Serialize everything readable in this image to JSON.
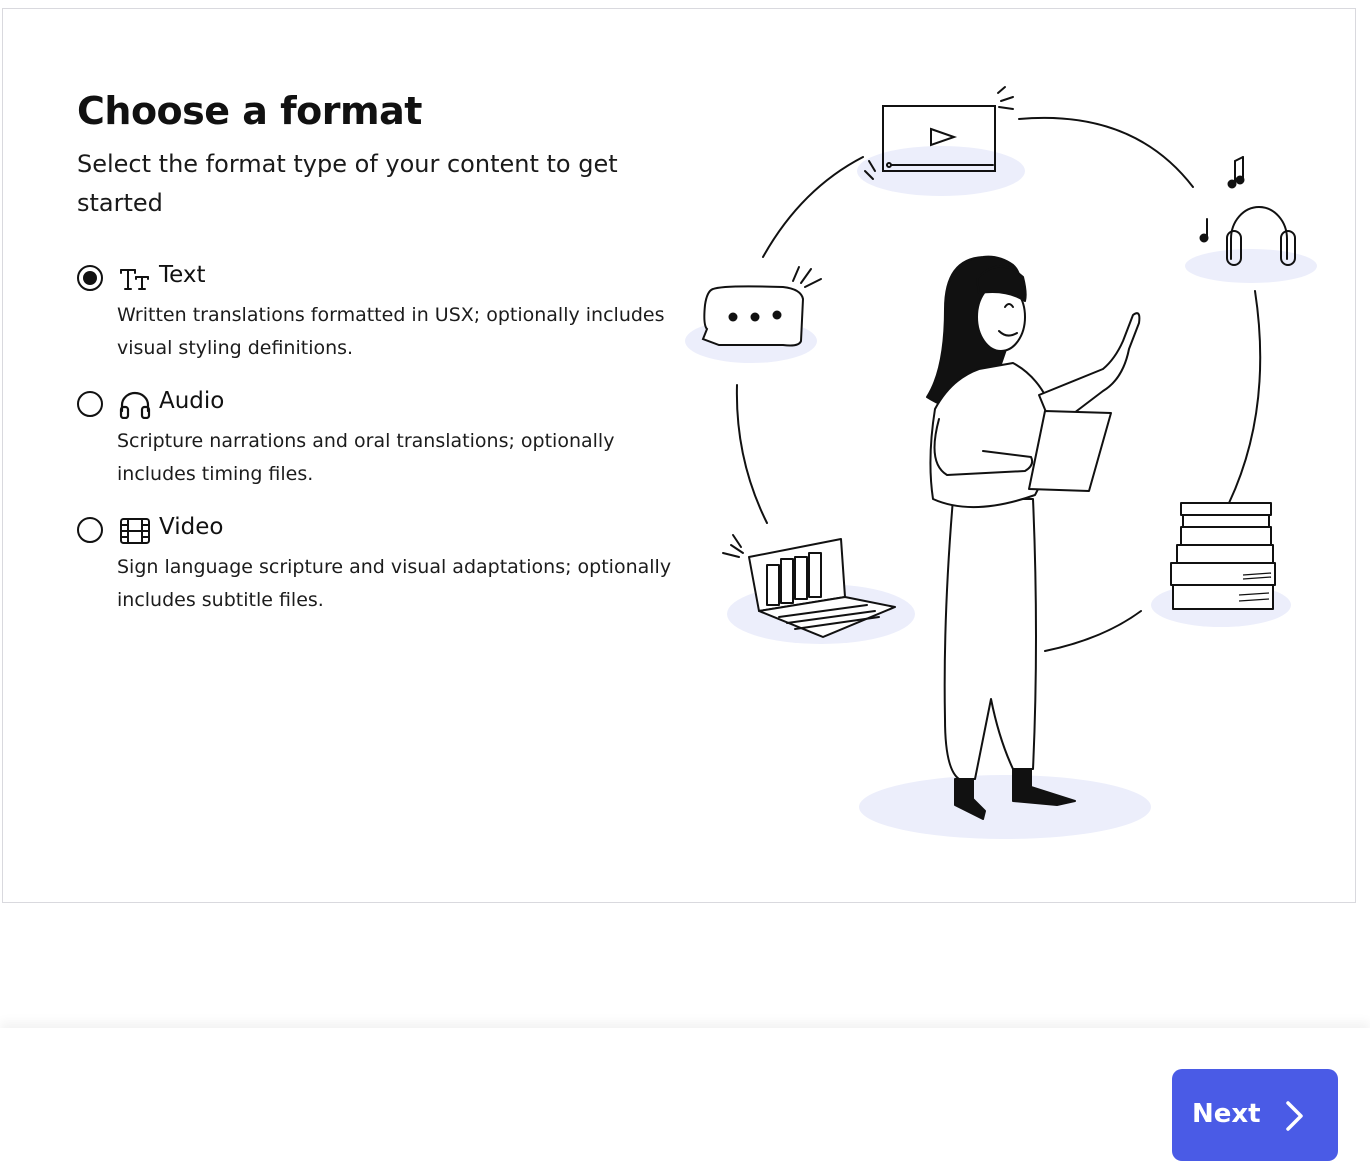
{
  "page": {
    "title": "Choose a format",
    "subtitle": "Select the format type of your content to get started"
  },
  "options": [
    {
      "label": "Text",
      "icon": "text-size-icon",
      "description": "Written translations formatted in USX; optionally includes visual styling definitions.",
      "selected": true
    },
    {
      "label": "Audio",
      "icon": "headphones-icon",
      "description": "Scripture narrations and oral translations; optionally includes timing files.",
      "selected": false
    },
    {
      "label": "Video",
      "icon": "film-icon",
      "description": "Sign language scripture and visual adaptations; optionally includes subtitle files.",
      "selected": false
    }
  ],
  "footer": {
    "next_label": "Next",
    "next_icon": "chevron-right-icon"
  },
  "colors": {
    "accent": "#4a5be6",
    "illustration_shadow": "#eceefb",
    "text": "#111111"
  }
}
